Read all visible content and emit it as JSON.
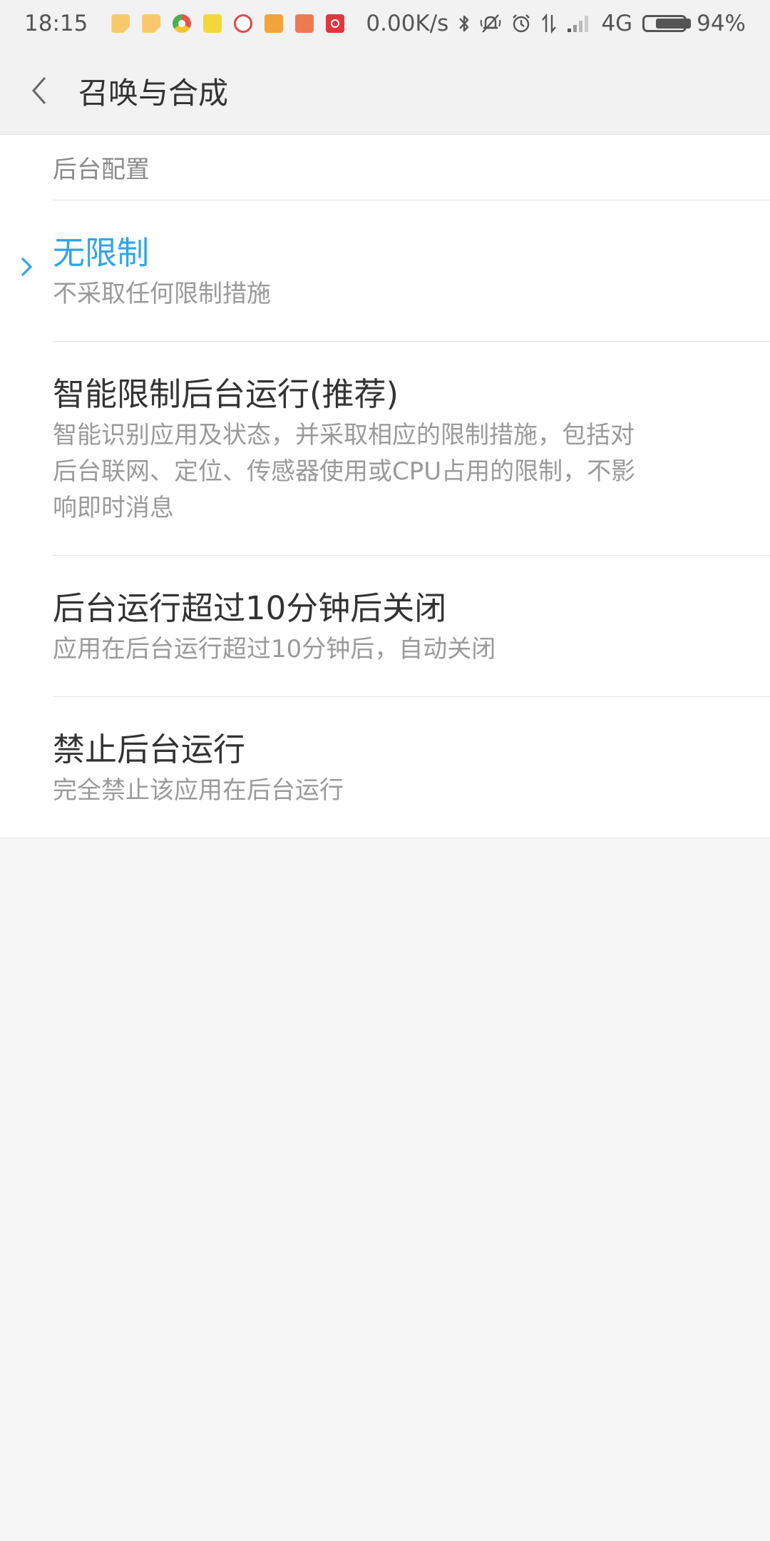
{
  "status_bar": {
    "time": "18:15",
    "net_speed": "0.00K/s",
    "network_type": "4G",
    "battery_percent": "94%",
    "battery_level": 0.94,
    "notification_icons": [
      "note-icon",
      "note-icon",
      "chrome-icon",
      "app-icon",
      "app-icon",
      "app-icon",
      "taobao-icon",
      "netease-icon"
    ],
    "status_icons": [
      "bluetooth-icon",
      "mute-icon",
      "alarm-icon",
      "data-transfer-icon",
      "signal-icon",
      "battery-icon"
    ]
  },
  "header": {
    "back_icon": "chevron-left-icon",
    "title": "召唤与合成"
  },
  "section": {
    "title": "后台配置"
  },
  "options": [
    {
      "title": "无限制",
      "desc": "不采取任何限制措施",
      "selected": true
    },
    {
      "title": "智能限制后台运行(推荐)",
      "desc": "智能识别应用及状态，并采取相应的限制措施，包括对后台联网、定位、传感器使用或CPU占用的限制，不影响即时消息",
      "selected": false
    },
    {
      "title": "后台运行超过10分钟后关闭",
      "desc": "应用在后台运行超过10分钟后，自动关闭",
      "selected": false
    },
    {
      "title": "禁止后台运行",
      "desc": "完全禁止该应用在后台运行",
      "selected": false
    }
  ],
  "colors": {
    "accent": "#2fa5ea",
    "background": "#f7f7f7",
    "header_bg": "#f2f2f2"
  }
}
